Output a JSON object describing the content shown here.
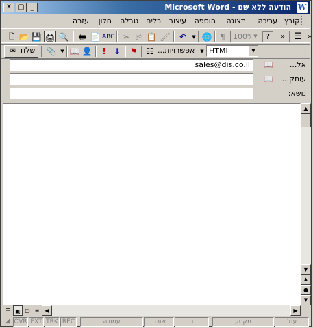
{
  "window": {
    "title": "הודעה ללא שם - Microsoft Word"
  },
  "menu": [
    "קובץ",
    "עריכה",
    "תצוגה",
    "הוספה",
    "עיצוב",
    "כלים",
    "טבלה",
    "חלון",
    "עזרה"
  ],
  "standard_toolbar": {
    "zoom": "100%"
  },
  "envelope_toolbar": {
    "send": "שלח",
    "options": "אפשרויות...",
    "format": "HTML"
  },
  "header": {
    "to_label": "אל...",
    "to_value": "sales@dis.co.il",
    "cc_label": "עותק...",
    "cc_value": "",
    "subject_label": "נושא:",
    "subject_value": ""
  },
  "status": {
    "page": "עמ'",
    "section": "מקטע",
    "at": "ב",
    "line": "שורה",
    "column": "עמודה",
    "rec": "REC",
    "trk": "TRK",
    "ext": "EXT",
    "ovr": "OVR"
  }
}
